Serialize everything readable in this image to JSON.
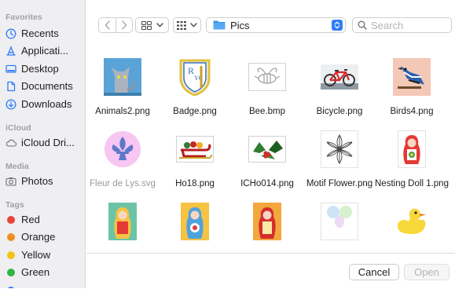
{
  "sidebar": {
    "sections": [
      {
        "title": "Favorites",
        "items": [
          {
            "label": "Recents",
            "icon": "clock-icon"
          },
          {
            "label": "Applicati...",
            "icon": "applications-icon"
          },
          {
            "label": "Desktop",
            "icon": "desktop-icon"
          },
          {
            "label": "Documents",
            "icon": "document-icon"
          },
          {
            "label": "Downloads",
            "icon": "download-icon"
          }
        ]
      },
      {
        "title": "iCloud",
        "items": [
          {
            "label": "iCloud Dri...",
            "icon": "cloud-icon"
          }
        ]
      },
      {
        "title": "Media",
        "items": [
          {
            "label": "Photos",
            "icon": "camera-icon"
          }
        ]
      },
      {
        "title": "Tags",
        "items": [
          {
            "label": "Red",
            "color": "#e9423b"
          },
          {
            "label": "Orange",
            "color": "#ef8f1c"
          },
          {
            "label": "Yellow",
            "color": "#f4c317"
          },
          {
            "label": "Green",
            "color": "#31b444"
          }
        ]
      }
    ]
  },
  "toolbar": {
    "back_icon": "chevron-left-icon",
    "forward_icon": "chevron-right-icon",
    "view_icon": "icon-grid-icon",
    "group_icon": "group-grid-icon",
    "folder_name": "Pics",
    "search_placeholder": "Search"
  },
  "files": [
    {
      "name": "Animals2.png",
      "dim": false
    },
    {
      "name": "Badge.png",
      "dim": false
    },
    {
      "name": "Bee.bmp",
      "dim": false
    },
    {
      "name": "Bicycle.png",
      "dim": false
    },
    {
      "name": "Birds4.png",
      "dim": false
    },
    {
      "name": "Fleur de Lys.svg",
      "dim": true
    },
    {
      "name": "Ho18.png",
      "dim": false
    },
    {
      "name": "ICHo014.png",
      "dim": false
    },
    {
      "name": "Motif Flower.png",
      "dim": false
    },
    {
      "name": "Nesting Doll 1.png",
      "dim": false
    },
    {
      "name": "",
      "dim": false
    },
    {
      "name": "",
      "dim": false
    },
    {
      "name": "",
      "dim": false
    },
    {
      "name": "",
      "dim": false
    },
    {
      "name": "",
      "dim": false
    }
  ],
  "footer": {
    "cancel_label": "Cancel",
    "open_label": "Open"
  },
  "colors": {
    "accent": "#2f7df6",
    "folder": "#3a92e8"
  }
}
